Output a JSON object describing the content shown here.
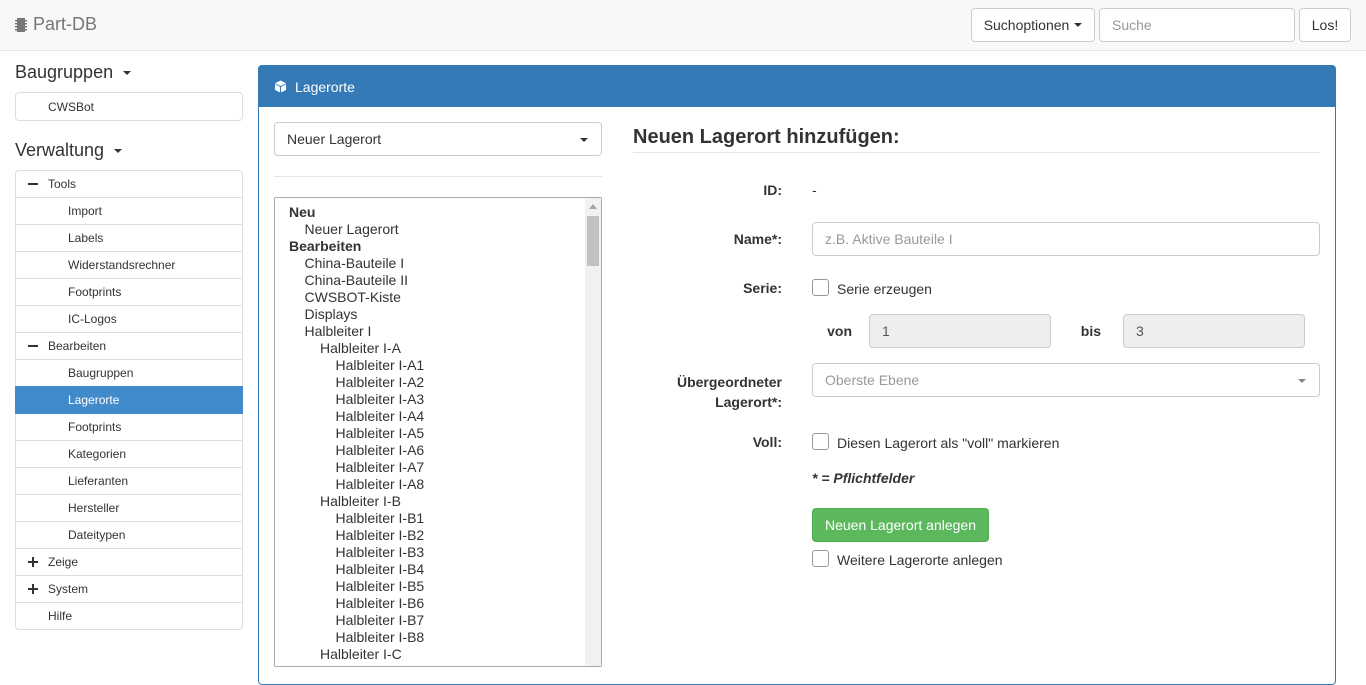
{
  "navbar": {
    "brand": "Part-DB",
    "search_options_label": "Suchoptionen",
    "search_placeholder": "Suche",
    "go_label": "Los!"
  },
  "sidebar": {
    "assemblies_heading": "Baugruppen",
    "assemblies": [
      "CWSBot"
    ],
    "admin_heading": "Verwaltung",
    "items": [
      {
        "label": "Tools",
        "level": 0,
        "toggle": "minus"
      },
      {
        "label": "Import",
        "level": 1
      },
      {
        "label": "Labels",
        "level": 1
      },
      {
        "label": "Widerstandsrechner",
        "level": 1
      },
      {
        "label": "Footprints",
        "level": 1
      },
      {
        "label": "IC-Logos",
        "level": 1
      },
      {
        "label": "Bearbeiten",
        "level": 0,
        "toggle": "minus"
      },
      {
        "label": "Baugruppen",
        "level": 1
      },
      {
        "label": "Lagerorte",
        "level": 1,
        "active": true
      },
      {
        "label": "Footprints",
        "level": 1
      },
      {
        "label": "Kategorien",
        "level": 1
      },
      {
        "label": "Lieferanten",
        "level": 1
      },
      {
        "label": "Hersteller",
        "level": 1
      },
      {
        "label": "Dateitypen",
        "level": 1
      },
      {
        "label": "Zeige",
        "level": 0,
        "toggle": "plus"
      },
      {
        "label": "System",
        "level": 0,
        "toggle": "plus"
      },
      {
        "label": "Hilfe",
        "level": 0
      }
    ]
  },
  "panel": {
    "title": "Lagerorte",
    "selector_value": "Neuer Lagerort",
    "tree": [
      {
        "label": "Neu",
        "depth": 0,
        "bold": true
      },
      {
        "label": "Neuer Lagerort",
        "depth": 1
      },
      {
        "label": "Bearbeiten",
        "depth": 0,
        "bold": true
      },
      {
        "label": "China-Bauteile I",
        "depth": 1
      },
      {
        "label": "China-Bauteile II",
        "depth": 1
      },
      {
        "label": "CWSBOT-Kiste",
        "depth": 1
      },
      {
        "label": "Displays",
        "depth": 1
      },
      {
        "label": "Halbleiter I",
        "depth": 1
      },
      {
        "label": "Halbleiter I-A",
        "depth": 2
      },
      {
        "label": "Halbleiter I-A1",
        "depth": 3
      },
      {
        "label": "Halbleiter I-A2",
        "depth": 3
      },
      {
        "label": "Halbleiter I-A3",
        "depth": 3
      },
      {
        "label": "Halbleiter I-A4",
        "depth": 3
      },
      {
        "label": "Halbleiter I-A5",
        "depth": 3
      },
      {
        "label": "Halbleiter I-A6",
        "depth": 3
      },
      {
        "label": "Halbleiter I-A7",
        "depth": 3
      },
      {
        "label": "Halbleiter I-A8",
        "depth": 3
      },
      {
        "label": "Halbleiter I-B",
        "depth": 2
      },
      {
        "label": "Halbleiter I-B1",
        "depth": 3
      },
      {
        "label": "Halbleiter I-B2",
        "depth": 3
      },
      {
        "label": "Halbleiter I-B3",
        "depth": 3
      },
      {
        "label": "Halbleiter I-B4",
        "depth": 3
      },
      {
        "label": "Halbleiter I-B5",
        "depth": 3
      },
      {
        "label": "Halbleiter I-B6",
        "depth": 3
      },
      {
        "label": "Halbleiter I-B7",
        "depth": 3
      },
      {
        "label": "Halbleiter I-B8",
        "depth": 3
      },
      {
        "label": "Halbleiter I-C",
        "depth": 2
      }
    ]
  },
  "form": {
    "title": "Neuen Lagerort hinzufügen:",
    "id_label": "ID:",
    "id_value": "-",
    "name_label": "Name*:",
    "name_placeholder": "z.B. Aktive Bauteile I",
    "series_label": "Serie:",
    "series_checkbox": "Serie erzeugen",
    "from_label": "von",
    "from_value": "1",
    "to_label": "bis",
    "to_value": "3",
    "parent_label_line1": "Übergeordneter",
    "parent_label_line2": "Lagerort*:",
    "parent_value": "Oberste Ebene",
    "full_label": "Voll:",
    "full_checkbox": "Diesen Lagerort als \"voll\" markieren",
    "required_note": "* = Pflichtfelder",
    "submit_label": "Neuen Lagerort anlegen",
    "more_checkbox": "Weitere Lagerorte anlegen"
  }
}
